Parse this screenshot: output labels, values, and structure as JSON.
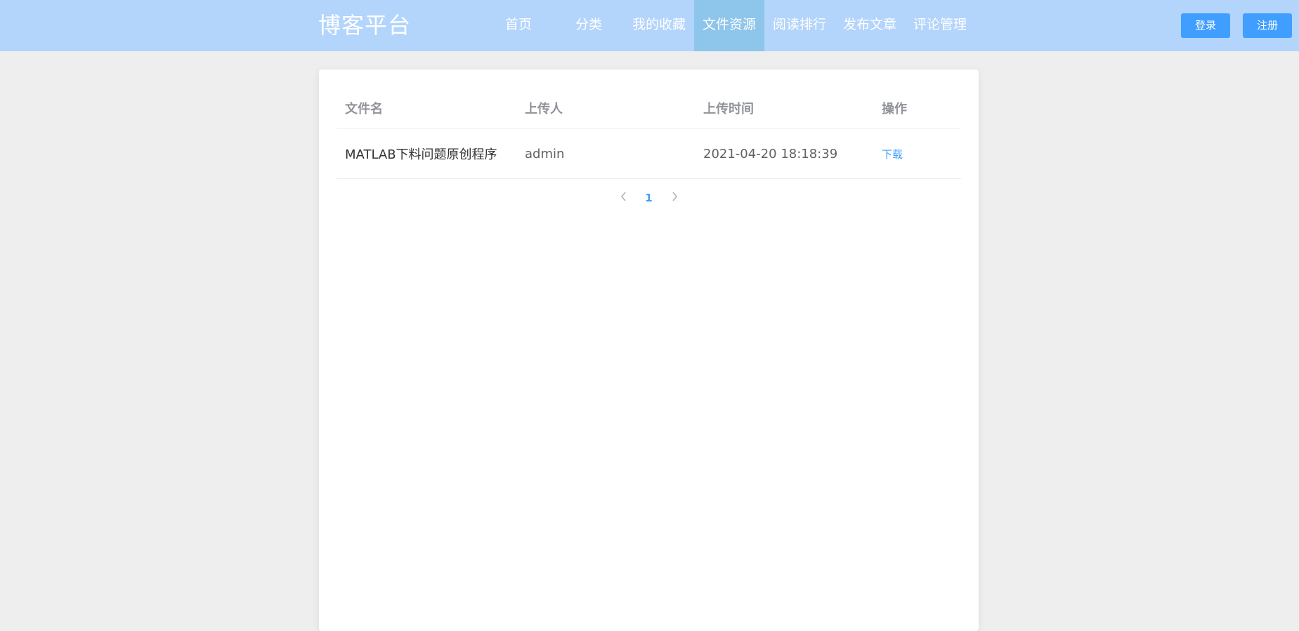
{
  "header": {
    "logo": "博客平台",
    "nav": [
      {
        "label": "首页",
        "active": false
      },
      {
        "label": "分类",
        "active": false
      },
      {
        "label": "我的收藏",
        "active": false
      },
      {
        "label": "文件资源",
        "active": true
      },
      {
        "label": "阅读排行",
        "active": false
      },
      {
        "label": "发布文章",
        "active": false
      },
      {
        "label": "评论管理",
        "active": false
      }
    ],
    "login_label": "登录",
    "register_label": "注册"
  },
  "table": {
    "columns": [
      "文件名",
      "上传人",
      "上传时间",
      "操作"
    ],
    "rows": [
      {
        "name": "MATLAB下料问题原创程序",
        "uploader": "admin",
        "time": "2021-04-20 18:18:39",
        "action": "下载"
      }
    ]
  },
  "pagination": {
    "prev_icon": "chevron-left-icon",
    "next_icon": "chevron-right-icon",
    "current_page": "1"
  },
  "colors": {
    "header_bg": "#b3d4fb",
    "nav_active_bg": "#8ec5ea",
    "primary": "#409eff",
    "page_bg": "#eeeeee"
  }
}
